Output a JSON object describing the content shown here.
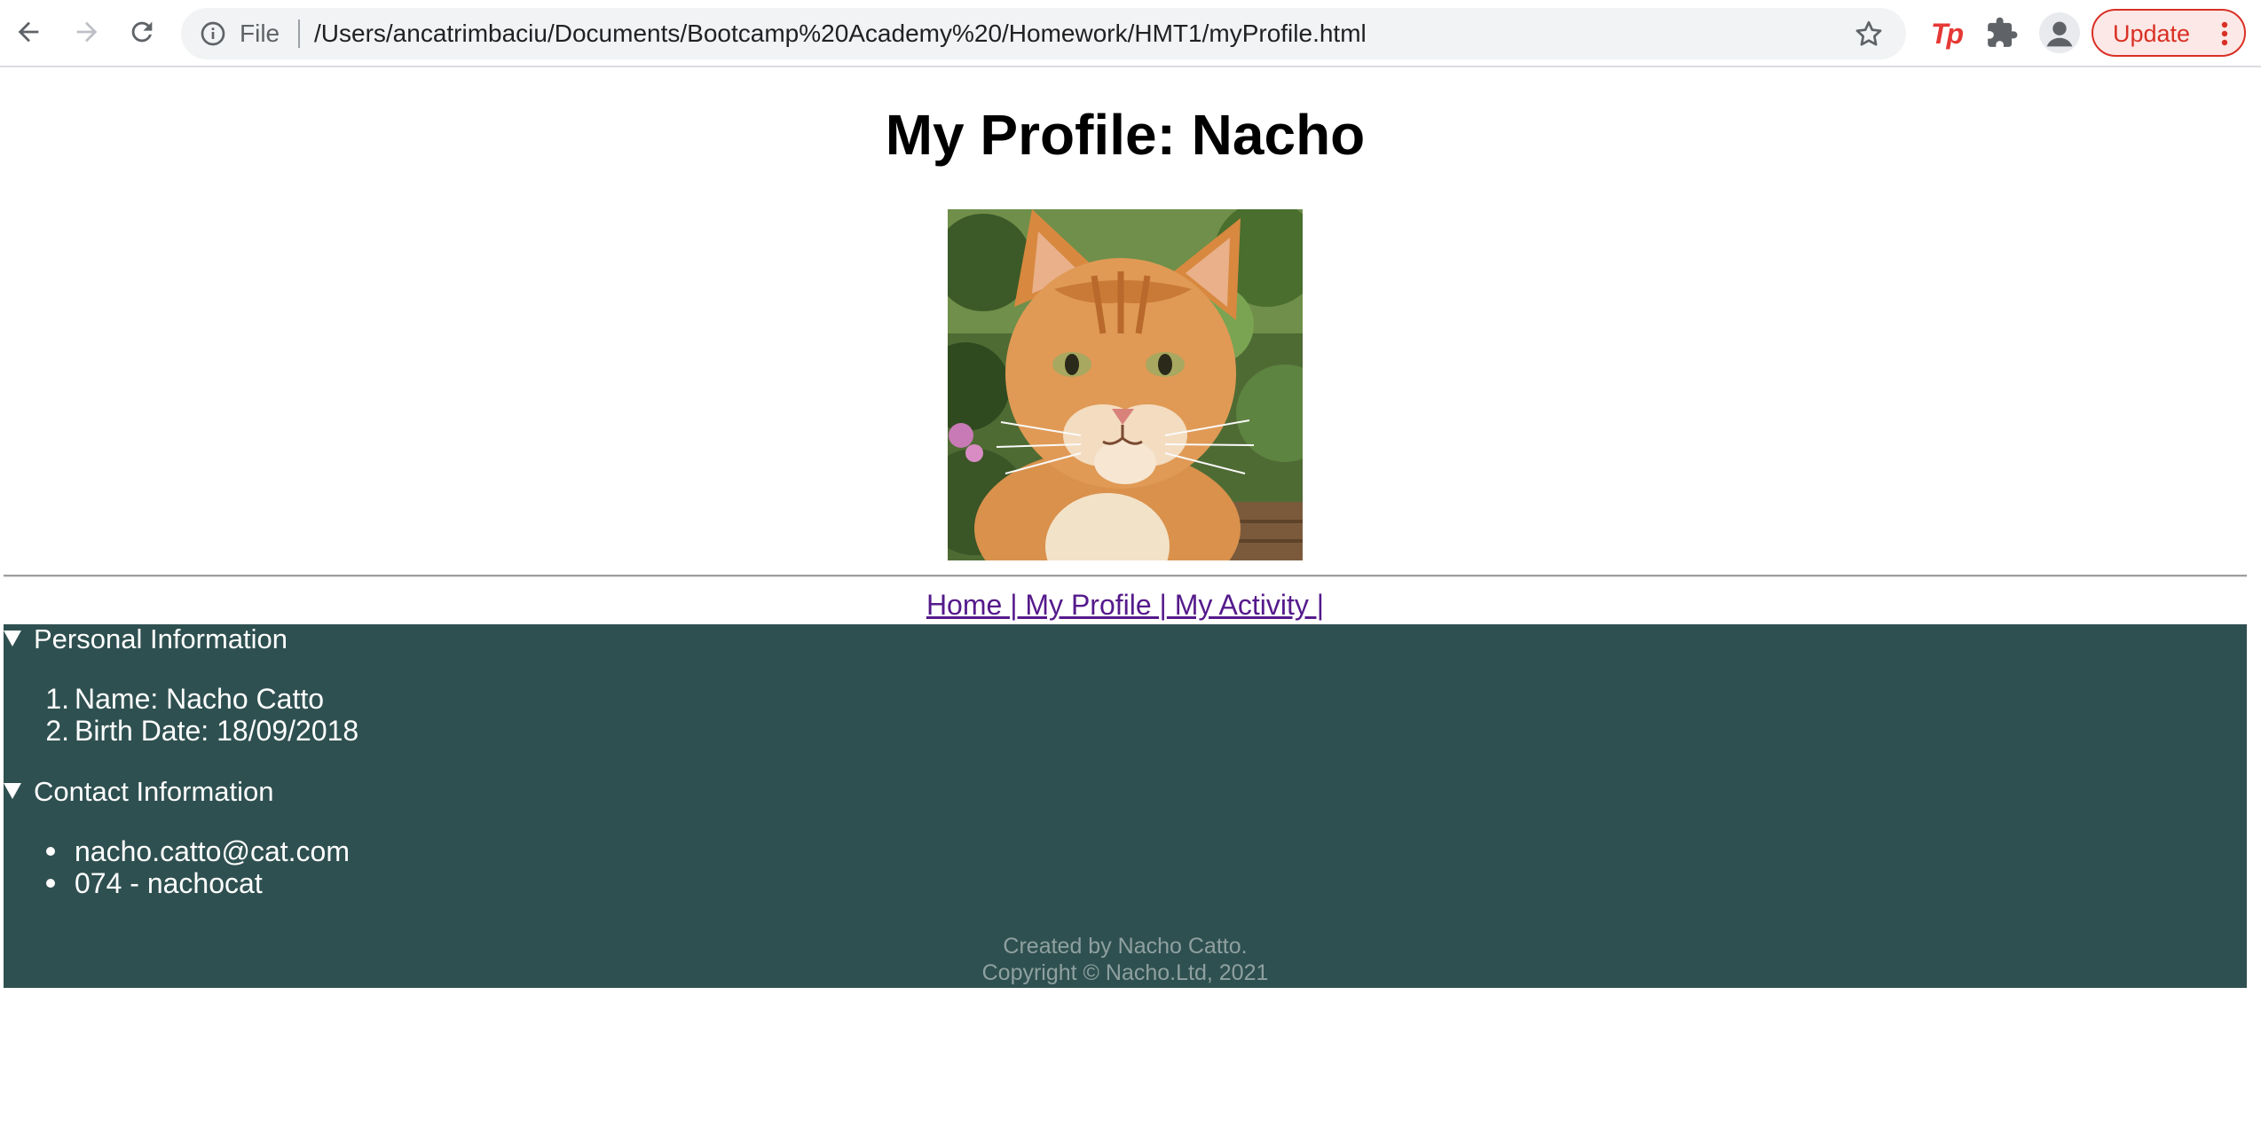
{
  "browser": {
    "scheme_label": "File",
    "url": "/Users/ancatrimbaciu/Documents/Bootcamp%20Academy%20/Homework/HMT1/myProfile.html",
    "extension_badge": "Tp",
    "update_label": "Update",
    "icons": [
      "back-icon",
      "forward-icon",
      "reload-icon",
      "info-icon",
      "star-icon",
      "puzzle-icon",
      "profile-icon",
      "kebab-icon"
    ],
    "accent_color": "#d93025"
  },
  "page": {
    "title": "My Profile: Nacho",
    "photo": "cat-photo",
    "nav": {
      "home": "Home |",
      "profile": " My Profile |",
      "activity": " My Activity |"
    },
    "personal": {
      "summary": "Personal Information",
      "items": [
        {
          "marker": "1.",
          "text": "Name: Nacho Catto"
        },
        {
          "marker": "2.",
          "text": "Birth Date: 18/09/2018"
        }
      ]
    },
    "contact": {
      "summary": "Contact Information",
      "items": [
        {
          "text": "nacho.catto@cat.com"
        },
        {
          "text": "074 - nachocat"
        }
      ]
    },
    "footer": {
      "line1": "Created by Nacho Catto.",
      "line2": "Copyright © Nacho.Ltd, 2021"
    },
    "colors": {
      "section_background": "#2f5050",
      "link": "#551a8b",
      "footer_text": "#8fa0a0"
    }
  }
}
